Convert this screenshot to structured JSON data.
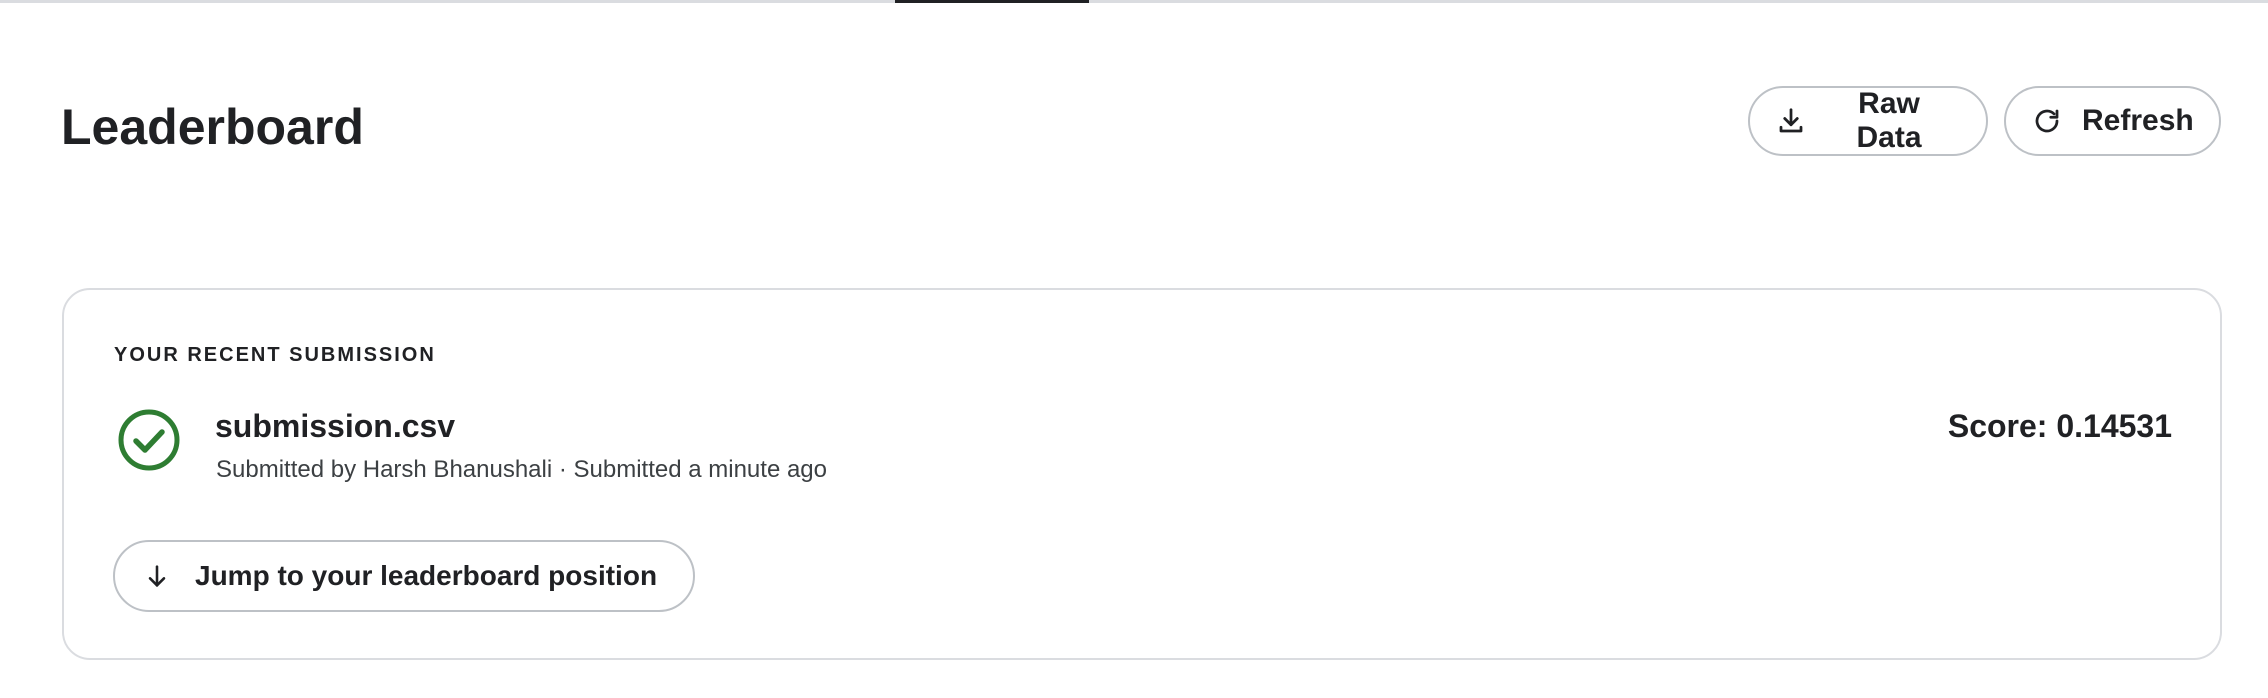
{
  "page": {
    "title": "Leaderboard"
  },
  "header_actions": {
    "raw_data_label": "Raw Data",
    "raw_data_icon": "download-icon",
    "refresh_label": "Refresh",
    "refresh_icon": "refresh-icon"
  },
  "recent_submission": {
    "heading": "YOUR RECENT SUBMISSION",
    "status_icon": "check-circle-icon",
    "status_color": "#2e7d32",
    "file_name": "submission.csv",
    "meta": "Submitted by Harsh Bhanushali · Submitted a minute ago",
    "score": "Score: 0.14531",
    "jump_label": "Jump to your leaderboard position",
    "jump_icon": "arrow-down-icon"
  },
  "colors": {
    "text": "#202124",
    "border": "#dadce0",
    "success": "#2e7d32"
  }
}
